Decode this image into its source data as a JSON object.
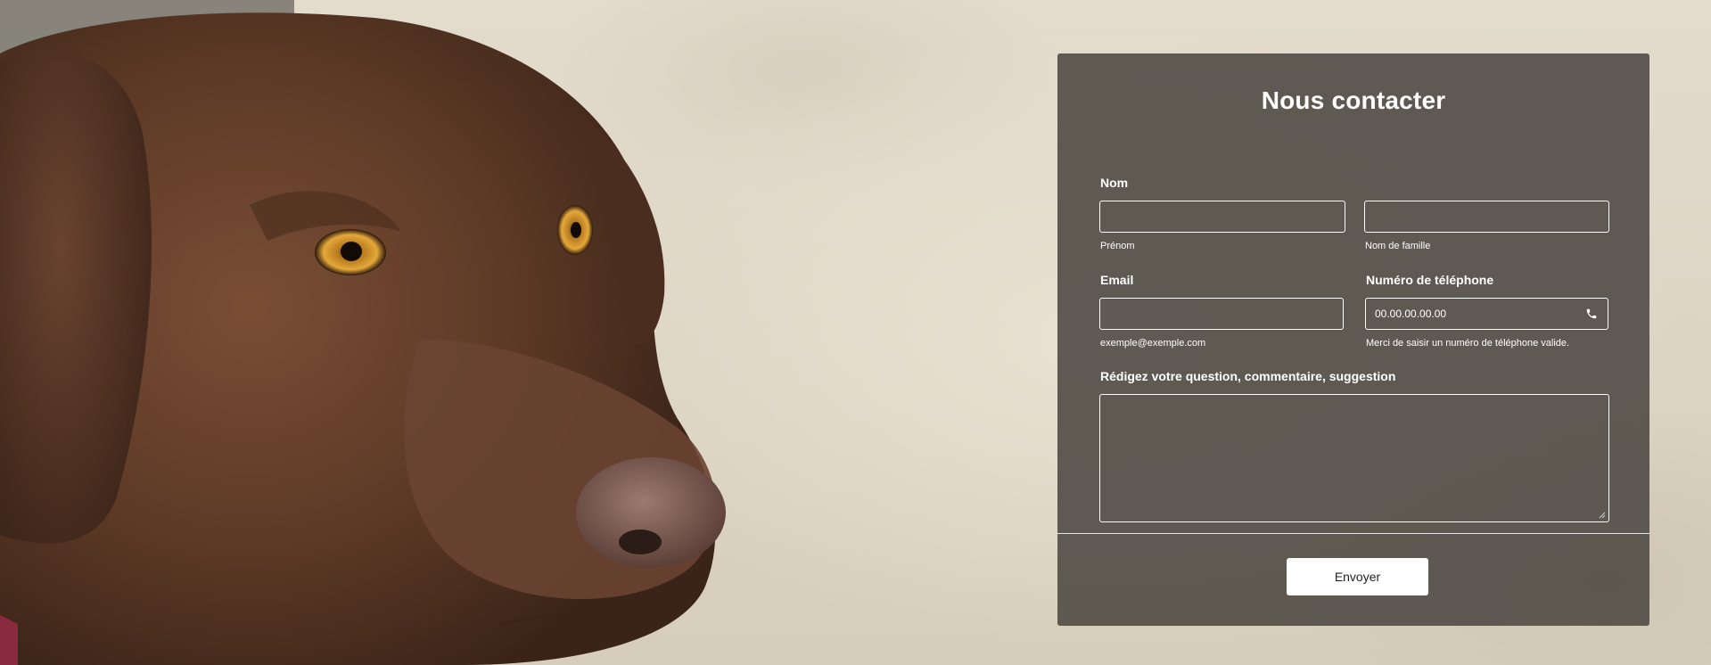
{
  "form": {
    "title": "Nous contacter",
    "name_label": "Nom",
    "first_name_hint": "Prénom",
    "last_name_hint": "Nom de famille",
    "email_label": "Email",
    "email_hint": "exemple@exemple.com",
    "phone_label": "Numéro de téléphone",
    "phone_placeholder": "00.00.00.00.00",
    "phone_hint": "Merci de saisir un numéro de téléphone valide.",
    "message_label": "Rédigez votre question, commentaire, suggestion",
    "submit_label": "Envoyer"
  },
  "icons": {
    "phone": "phone-icon",
    "resize": "resize-grip-icon"
  },
  "colors": {
    "card_bg": "#524e48",
    "text": "#ffffff",
    "button_bg": "#ffffff",
    "button_text": "#222222"
  }
}
